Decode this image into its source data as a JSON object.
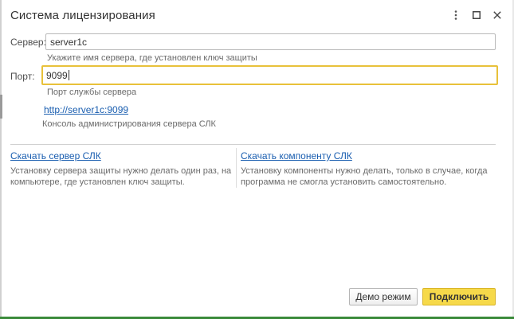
{
  "window": {
    "title": "Система лицензирования"
  },
  "form": {
    "server": {
      "label": "Сервер:",
      "value": "server1c",
      "hint": "Укажите имя сервера, где установлен ключ защиты"
    },
    "port": {
      "label": "Порт:",
      "value": "9099",
      "hint": "Порт службы сервера"
    },
    "console": {
      "link": "http://server1c:9099",
      "hint": "Консоль администрирования сервера СЛК"
    }
  },
  "downloads": {
    "server": {
      "link": "Скачать сервер СЛК",
      "line1": "Установку сервера защиты нужно делать один раз, на",
      "line2": "компьютере, где установлен ключ защиты."
    },
    "component": {
      "link": "Скачать компоненту СЛК",
      "line1": "Установку компоненты нужно делать, только в случае, когда",
      "line2": "программа не смогла установить самостоятельно."
    }
  },
  "buttons": {
    "demo": "Демо режим",
    "connect": "Подключить"
  },
  "icons": {
    "more": "more-vertical-icon",
    "maximize": "maximize-icon",
    "close": "close-icon"
  },
  "colors": {
    "accent": "#f6d94a",
    "focus_border": "#e8c13a",
    "link": "#1a5eb0",
    "status_line": "#3a8a3a"
  }
}
